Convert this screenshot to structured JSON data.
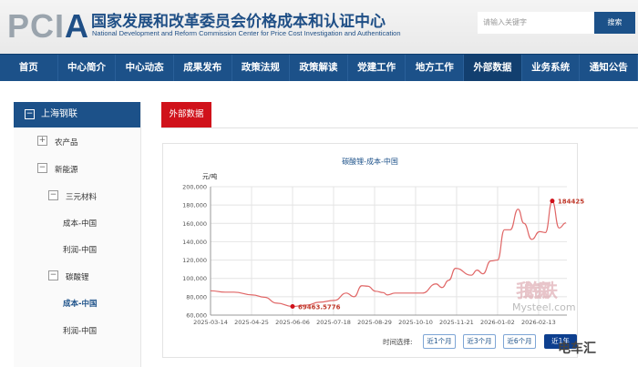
{
  "header": {
    "logo_main": "PCI",
    "logo_last": "A",
    "title_cn": "国家发展和改革委员会价格成本和认证中心",
    "title_en": "National Development and Reform Commission Center for Price Cost Investigation and Authentication",
    "search_placeholder": "请输入关键字",
    "search_button": "搜索"
  },
  "nav": [
    "首页",
    "中心简介",
    "中心动态",
    "成果发布",
    "政策法规",
    "政策解读",
    "党建工作",
    "地方工作",
    "外部数据",
    "业务系统",
    "通知公告"
  ],
  "sidebar": {
    "title": "上海钢联",
    "items": [
      {
        "label": "农产品",
        "toggle": "+"
      },
      {
        "label": "新能源",
        "toggle": "−"
      },
      {
        "label": "三元材料",
        "toggle": "−"
      },
      {
        "label": "成本-中国"
      },
      {
        "label": "利润-中国"
      },
      {
        "label": "碳酸锂",
        "toggle": "−"
      },
      {
        "label": "成本-中国",
        "active": true
      },
      {
        "label": "利润-中国"
      }
    ]
  },
  "main": {
    "tab": "外部数据",
    "time_label": "时间选择:",
    "time_buttons": [
      "近1个月",
      "近3个月",
      "近6个月",
      "近1年"
    ],
    "active_button": 3
  },
  "watermark": {
    "mysteel": "Mysteel.com",
    "mysteel_cn": "我的钢铁",
    "weibo": "电车汇"
  },
  "colors": {
    "brand": "#1c5189",
    "accent": "#d0121b",
    "line": "#e06666"
  },
  "chart_data": {
    "type": "line",
    "title": "碳酸锂-成本-中国",
    "ylabel": "元/吨",
    "ylim": [
      60000,
      200000
    ],
    "yticks": [
      "60,000",
      "80,000",
      "100,000",
      "120,000",
      "140,000",
      "160,000",
      "180,000",
      "200,000"
    ],
    "xticks": [
      "2025-03-14",
      "2025-04-25",
      "2025-06-06",
      "2025-07-18",
      "2025-08-29",
      "2025-10-10",
      "2025-11-21",
      "2026-01-02",
      "2026-02-13"
    ],
    "x_unit": "days since 2025-03-14",
    "xlim": [
      0,
      365
    ],
    "x": [
      0,
      15,
      24,
      43,
      55,
      68,
      84,
      99,
      111,
      127,
      139,
      147,
      155,
      161,
      169,
      177,
      181,
      189,
      211,
      217,
      231,
      237,
      244,
      251,
      267,
      273,
      279,
      287,
      294,
      301,
      307,
      315,
      321,
      329,
      337,
      343,
      350,
      357,
      364
    ],
    "values": [
      86500,
      85000,
      85000,
      82000,
      79500,
      73000,
      69463.5776,
      71000,
      74000,
      76000,
      84000,
      80000,
      92000,
      91500,
      86000,
      84500,
      82000,
      84000,
      84000,
      84000,
      94000,
      90000,
      98000,
      111000,
      103500,
      109000,
      105000,
      119000,
      120000,
      153000,
      153000,
      175500,
      160000,
      142500,
      151000,
      150000,
      184425,
      155000,
      160500
    ],
    "annotations": [
      {
        "label": "69463.5776",
        "x": 84,
        "y": 69463.5776
      },
      {
        "label": "184425",
        "x": 350,
        "y": 184425
      }
    ],
    "grid": true
  }
}
